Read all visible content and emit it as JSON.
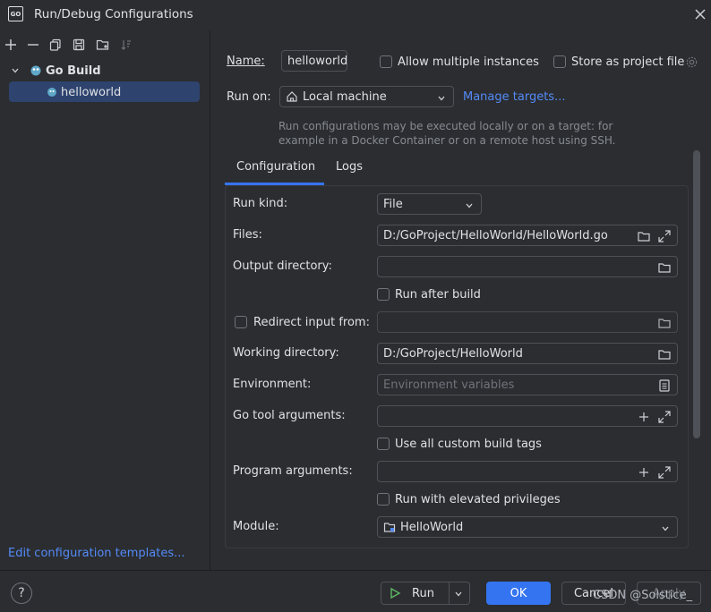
{
  "window": {
    "title": "Run/Debug Configurations",
    "logo_text": "GO"
  },
  "sidebar": {
    "group_label": "Go Build",
    "item_label": "helloworld",
    "footer_link": "Edit configuration templates..."
  },
  "header": {
    "name_label": "Name:",
    "name_value": "helloworld",
    "allow_multiple_label": "Allow multiple instances",
    "store_project_label": "Store as project file",
    "run_on_label": "Run on:",
    "run_on_value": "Local machine",
    "manage_targets": "Manage targets...",
    "hint_line1": "Run configurations may be executed locally or on a target: for",
    "hint_line2": "example in a Docker Container or on a remote host using SSH."
  },
  "tabs": {
    "configuration": "Configuration",
    "logs": "Logs"
  },
  "form": {
    "run_kind_label": "Run kind:",
    "run_kind_value": "File",
    "files_label": "Files:",
    "files_value": "D:/GoProject/HelloWorld/HelloWorld.go",
    "output_dir_label": "Output directory:",
    "run_after_build_label": "Run after build",
    "redirect_input_label": "Redirect input from:",
    "working_dir_label": "Working directory:",
    "working_dir_value": "D:/GoProject/HelloWorld",
    "environment_label": "Environment:",
    "environment_placeholder": "Environment variables",
    "go_tool_args_label": "Go tool arguments:",
    "custom_build_tags_label": "Use all custom build tags",
    "program_args_label": "Program arguments:",
    "elevated_label": "Run with elevated privileges",
    "module_label": "Module:",
    "module_value": "HelloWorld"
  },
  "footer": {
    "help": "?",
    "run": "Run",
    "ok": "OK",
    "cancel": "Cancel",
    "apply": "Apply",
    "watermark": "CSDN @Solstice_"
  },
  "colors": {
    "accent": "#3574f0",
    "link": "#548af7",
    "background": "#2b2d30",
    "selection": "#2e436e"
  }
}
